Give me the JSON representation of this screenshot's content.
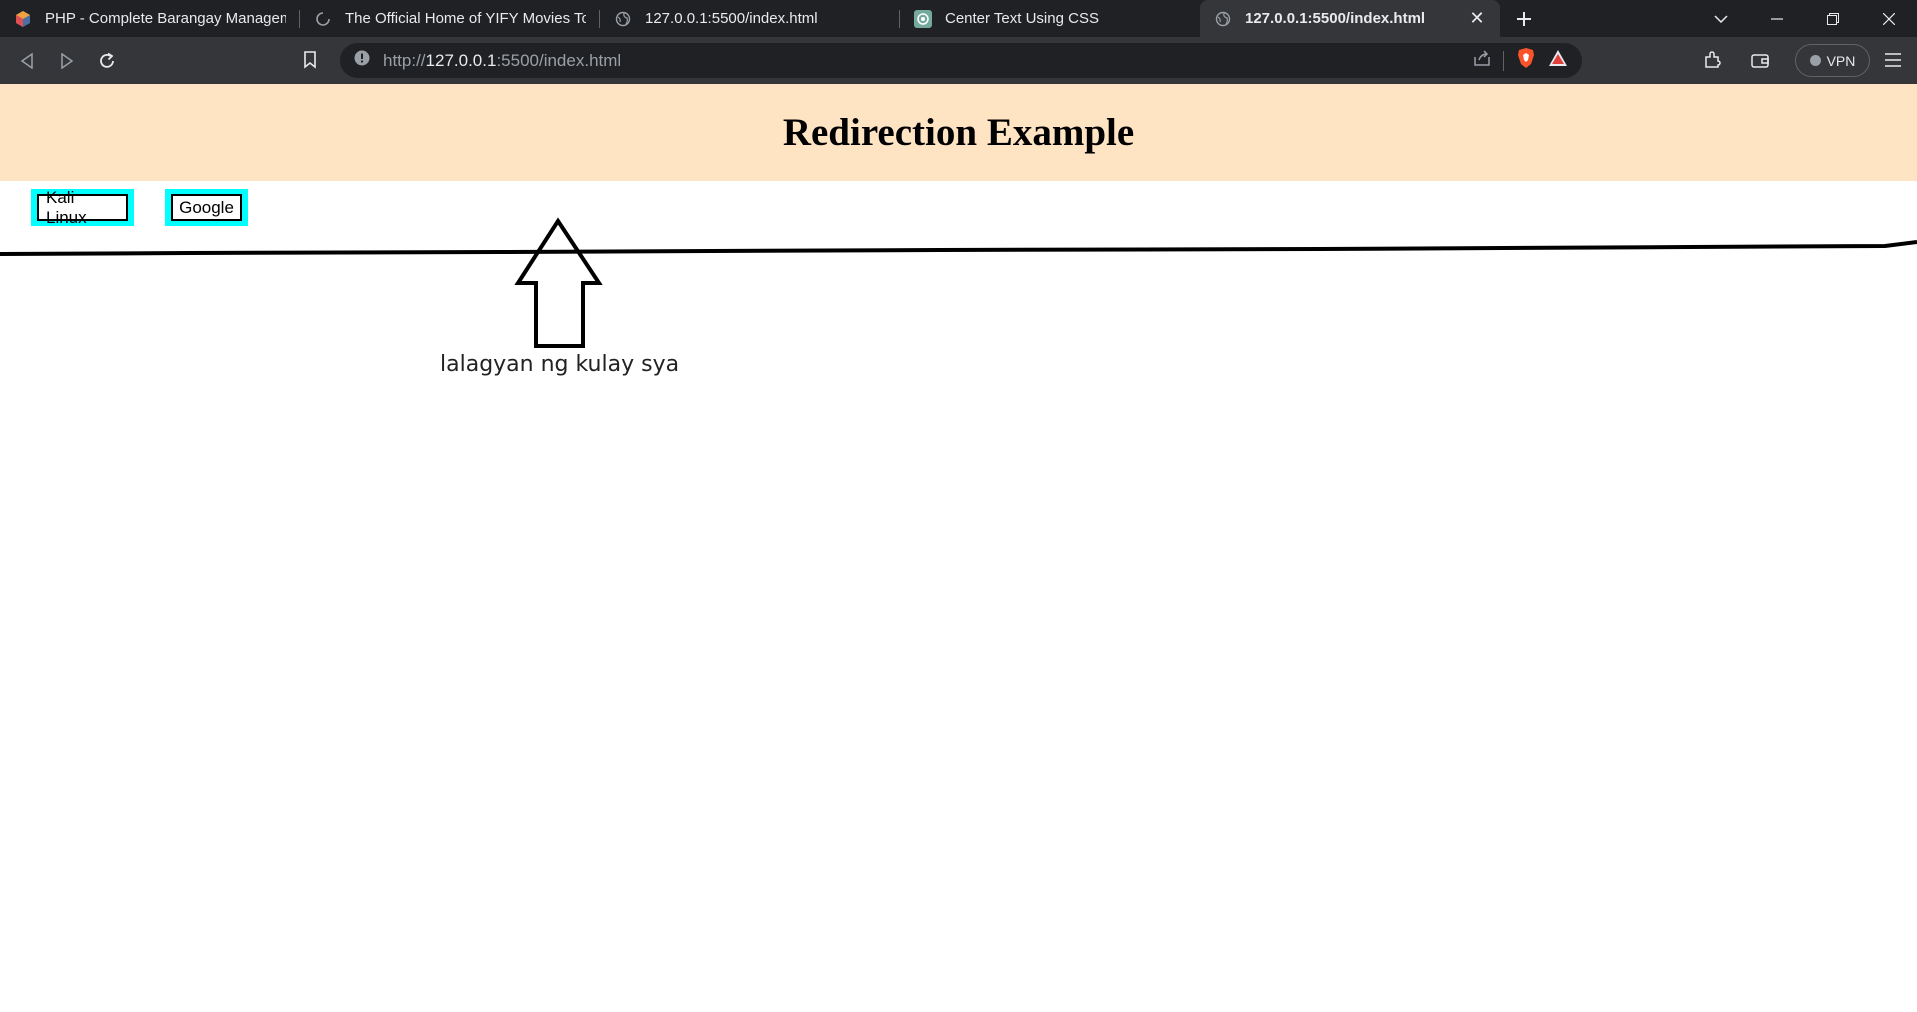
{
  "browser": {
    "tabs": [
      {
        "title": "PHP - Complete Barangay Manageme",
        "icon": "php-project-icon",
        "active": false
      },
      {
        "title": "The Official Home of YIFY Movies Torr",
        "icon": "loading-spinner-icon",
        "active": false
      },
      {
        "title": "127.0.0.1:5500/index.html",
        "icon": "globe-icon",
        "active": false
      },
      {
        "title": "Center Text Using CSS",
        "icon": "chatgpt-icon",
        "active": false
      },
      {
        "title": "127.0.0.1:5500/index.html",
        "icon": "globe-icon",
        "active": true
      }
    ],
    "url": {
      "scheme": "http://",
      "host": "127.0.0.1",
      "rest": ":5500/index.html"
    },
    "vpn_label": "VPN"
  },
  "page": {
    "heading": "Redirection Example",
    "links": [
      {
        "label": "Kali Linux"
      },
      {
        "label": "Google"
      }
    ],
    "annotation": "lalagyan ng kulay sya"
  },
  "colors": {
    "header_bg": "#ffe4c4",
    "link_border": "#00ffff"
  }
}
